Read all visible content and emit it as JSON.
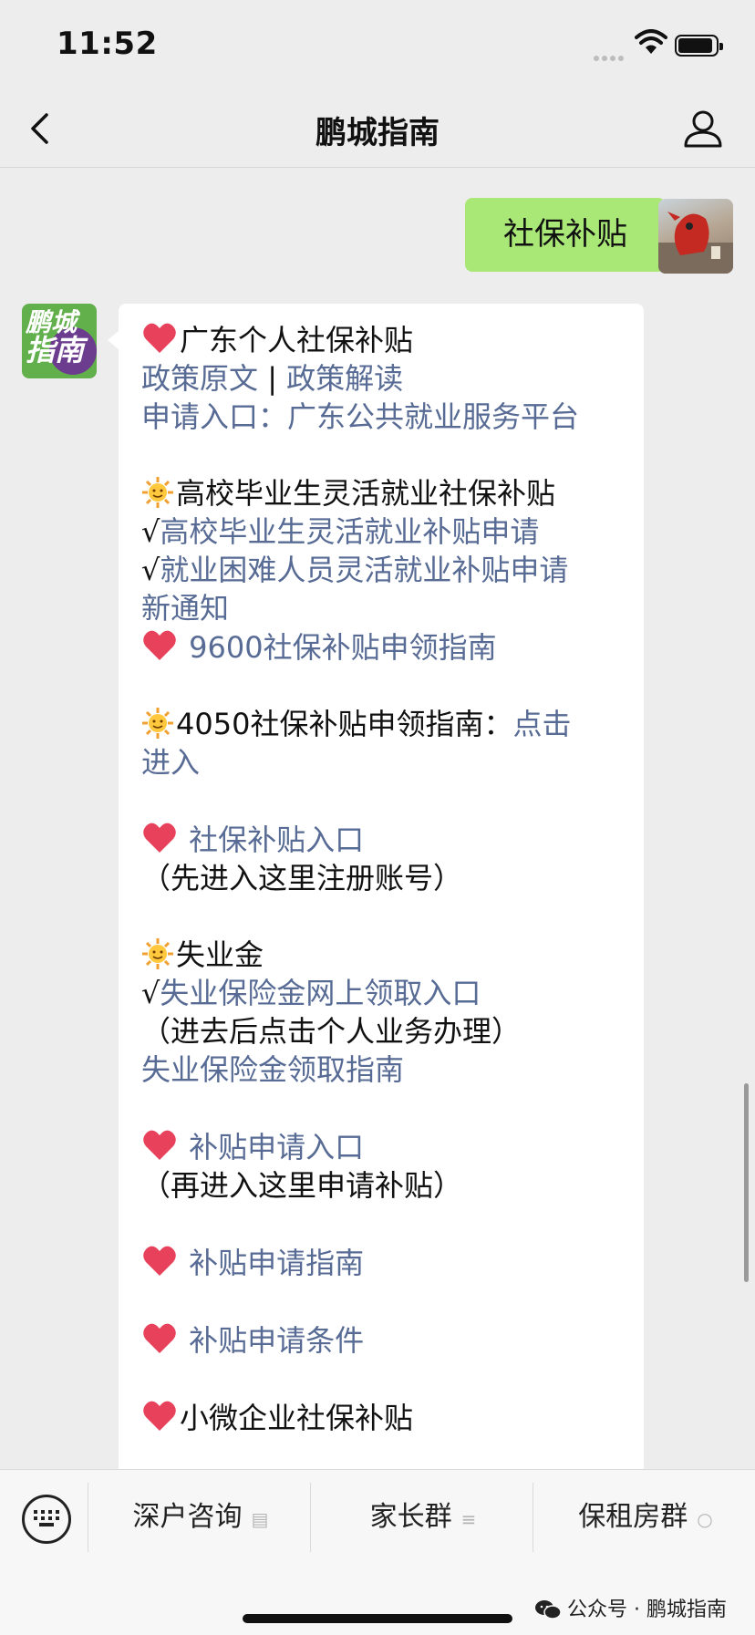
{
  "status": {
    "time": "11:52"
  },
  "nav": {
    "title": "鹏城指南"
  },
  "messages": {
    "user_message": "社保补贴",
    "bot_avatar": {
      "line1": "鹏城",
      "line2": "指南"
    }
  },
  "reply": {
    "s1_title": "广东个人社保补贴",
    "s1_link_a": "政策原文",
    "s1_sep": " | ",
    "s1_link_b": "政策解读",
    "s1_entry": "申请入口：广东公共就业服务平台",
    "s2_title": "高校毕业生灵活就业社保补贴",
    "check": "√",
    "s2_link1": "高校毕业生灵活就业补贴申请",
    "s2_link2a": "就业困难人员灵活就业补贴申请",
    "s2_link2b": "新通知",
    "s3_link": "9600社保补贴申领指南",
    "s4_title": "4050社保补贴申领指南：",
    "s4_link_a": "点击",
    "s4_link_b": "进入",
    "s5_link": "社保补贴入口",
    "s5_note": "（先进入这里注册账号）",
    "s6_title": "失业金",
    "s6_link1": "失业保险金网上领取入口",
    "s6_note": "（进去后点击个人业务办理）",
    "s6_link2": "失业保险金领取指南",
    "s7_link": "补贴申请入口",
    "s7_note": "（再进入这里申请补贴）",
    "s8_link": "补贴申请指南",
    "s9_link": "补贴申请条件",
    "s10_title": "小微企业社保补贴"
  },
  "bottom_menu": {
    "items": [
      {
        "label": "深户咨询",
        "icon": "doc-icon"
      },
      {
        "label": "家长群",
        "icon": "list-icon"
      },
      {
        "label": "保租房群",
        "icon": "bubble-icon"
      }
    ],
    "footer": "公众号 · 鹏城指南"
  },
  "colors": {
    "link": "#576b95",
    "user_bubble": "#a9e776",
    "background": "#ededed",
    "heart": "#e8415b"
  },
  "icons": [
    "back-chevron-icon",
    "person-icon",
    "heart-icon",
    "sun-icon",
    "keyboard-icon",
    "wechat-icon",
    "wifi-icon",
    "battery-icon"
  ]
}
